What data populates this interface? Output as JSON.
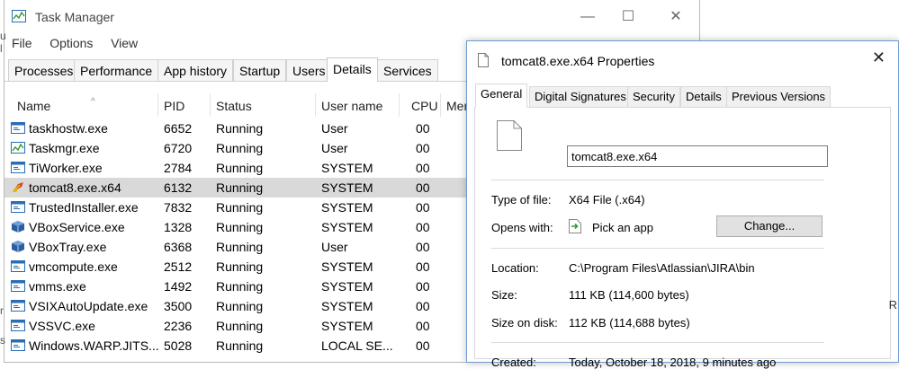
{
  "taskmanager": {
    "title": "Task Manager",
    "window_buttons": {
      "minimize": "—",
      "maximize": "☐",
      "close": "✕"
    },
    "menu": [
      "File",
      "Options",
      "View"
    ],
    "tabs": [
      "Processes",
      "Performance",
      "App history",
      "Startup",
      "Users",
      "Details",
      "Services"
    ],
    "active_tab": "Details",
    "columns": {
      "name": "Name",
      "pid": "PID",
      "status": "Status",
      "user": "User name",
      "cpu": "CPU",
      "mem": "Mer"
    },
    "rows": [
      {
        "name": "taskhostw.exe",
        "pid": "6652",
        "status": "Running",
        "user": "User",
        "cpu": "00"
      },
      {
        "name": "Taskmgr.exe",
        "pid": "6720",
        "status": "Running",
        "user": "User",
        "cpu": "00"
      },
      {
        "name": "TiWorker.exe",
        "pid": "2784",
        "status": "Running",
        "user": "SYSTEM",
        "cpu": "00"
      },
      {
        "name": "tomcat8.exe.x64",
        "pid": "6132",
        "status": "Running",
        "user": "SYSTEM",
        "cpu": "00"
      },
      {
        "name": "TrustedInstaller.exe",
        "pid": "7832",
        "status": "Running",
        "user": "SYSTEM",
        "cpu": "00"
      },
      {
        "name": "VBoxService.exe",
        "pid": "1328",
        "status": "Running",
        "user": "SYSTEM",
        "cpu": "00"
      },
      {
        "name": "VBoxTray.exe",
        "pid": "6368",
        "status": "Running",
        "user": "User",
        "cpu": "00"
      },
      {
        "name": "vmcompute.exe",
        "pid": "2512",
        "status": "Running",
        "user": "SYSTEM",
        "cpu": "00"
      },
      {
        "name": "vmms.exe",
        "pid": "1492",
        "status": "Running",
        "user": "SYSTEM",
        "cpu": "00"
      },
      {
        "name": "VSIXAutoUpdate.exe",
        "pid": "3500",
        "status": "Running",
        "user": "SYSTEM",
        "cpu": "00"
      },
      {
        "name": "VSSVC.exe",
        "pid": "2236",
        "status": "Running",
        "user": "SYSTEM",
        "cpu": "00"
      },
      {
        "name": "Windows.WARP.JITS...",
        "pid": "5028",
        "status": "Running",
        "user": "LOCAL SE...",
        "cpu": "00"
      }
    ],
    "selected_row": "tomcat8.exe.x64"
  },
  "properties": {
    "title": "tomcat8.exe.x64 Properties",
    "close": "✕",
    "tabs": [
      "General",
      "Digital Signatures",
      "Security",
      "Details",
      "Previous Versions"
    ],
    "active_tab": "General",
    "file_name_value": "tomcat8.exe.x64",
    "type_label": "Type of file:",
    "type_value": "X64 File (.x64)",
    "opens_label": "Opens with:",
    "opens_value": "Pick an app",
    "change_button": "Change...",
    "location_label": "Location:",
    "location_value": "C:\\Program Files\\Atlassian\\JIRA\\bin",
    "size_label": "Size:",
    "size_value": "111 KB (114,600 bytes)",
    "size_disk_label": "Size on disk:",
    "size_disk_value": "112 KB (114,688 bytes)",
    "created_label": "Created:",
    "created_value": "Today, October 18, 2018, 9 minutes ago"
  },
  "edge_fragments": {
    "right_char": "R",
    "left_chars": [
      "u",
      "l",
      "r",
      "s"
    ]
  },
  "colors": {
    "selected_row": "#d9d9d9",
    "dialog_border": "#6f9ad3",
    "button_face": "#e1e1e1"
  }
}
